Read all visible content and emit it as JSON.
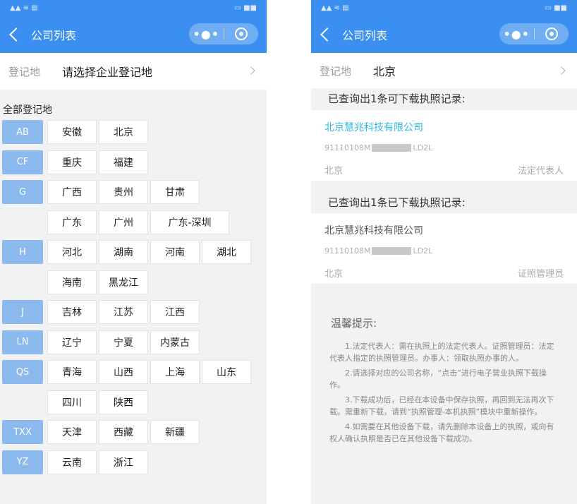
{
  "left": {
    "nav_title": "公司列表",
    "registration": {
      "label": "登记地",
      "value": "请选择企业登记地"
    },
    "all_title": "全部登记地",
    "groups": [
      {
        "letter": "AB",
        "rows": [
          [
            "安徽",
            "北京"
          ]
        ]
      },
      {
        "letter": "CF",
        "rows": [
          [
            "重庆",
            "福建"
          ]
        ]
      },
      {
        "letter": "G",
        "rows": [
          [
            "广西",
            "贵州",
            "甘肃"
          ],
          [
            "广东",
            "广州",
            "广东-深圳"
          ]
        ]
      },
      {
        "letter": "H",
        "rows": [
          [
            "河北",
            "湖南",
            "河南",
            "湖北"
          ],
          [
            "海南",
            "黑龙江"
          ]
        ]
      },
      {
        "letter": "J",
        "rows": [
          [
            "吉林",
            "江苏",
            "江西"
          ]
        ]
      },
      {
        "letter": "LN",
        "rows": [
          [
            "辽宁",
            "宁夏",
            "内蒙古"
          ]
        ]
      },
      {
        "letter": "QS",
        "rows": [
          [
            "青海",
            "山西",
            "上海",
            "山东"
          ],
          [
            "四川",
            "陕西"
          ]
        ]
      },
      {
        "letter": "TXX",
        "rows": [
          [
            "天津",
            "西藏",
            "新疆"
          ]
        ]
      },
      {
        "letter": "YZ",
        "rows": [
          [
            "云南",
            "浙江"
          ]
        ]
      }
    ]
  },
  "right": {
    "nav_title": "公司列表",
    "registration": {
      "label": "登记地",
      "value": "北京"
    },
    "section_downloadable": "已查询出1条可下载执照记录:",
    "section_downloaded": "已查询出1条已下载执照记录:",
    "card1": {
      "company": "北京慧兆科技有限公司",
      "code_prefix": "91110108M",
      "code_suffix": "LD2L",
      "city": "北京",
      "role": "法定代表人"
    },
    "card2": {
      "company": "北京慧兆科技有限公司",
      "code_prefix": "91110108M",
      "code_suffix": "LD2L",
      "city": "北京",
      "role": "证照管理员"
    },
    "notice_title": "温馨提示:",
    "notice_paragraphs": [
      "1.法定代表人：需在执照上的法定代表人。证照管理员：法定代表人指定的执照管理员。办事人：领取执照办事的人。",
      "2.请选择对应的公司名称，“点击”进行电子营业执照下载操作。",
      "3.下载成功后，已经在本设备中保存执照，再回到无法再次下载。需重新下载，请到“执照管理-本机执照”模块中重新操作。",
      "4.如需要在其他设备下载，请先删除本设备上的执照，或向有权人确认执照是否已在其他设备下载成功。"
    ]
  }
}
